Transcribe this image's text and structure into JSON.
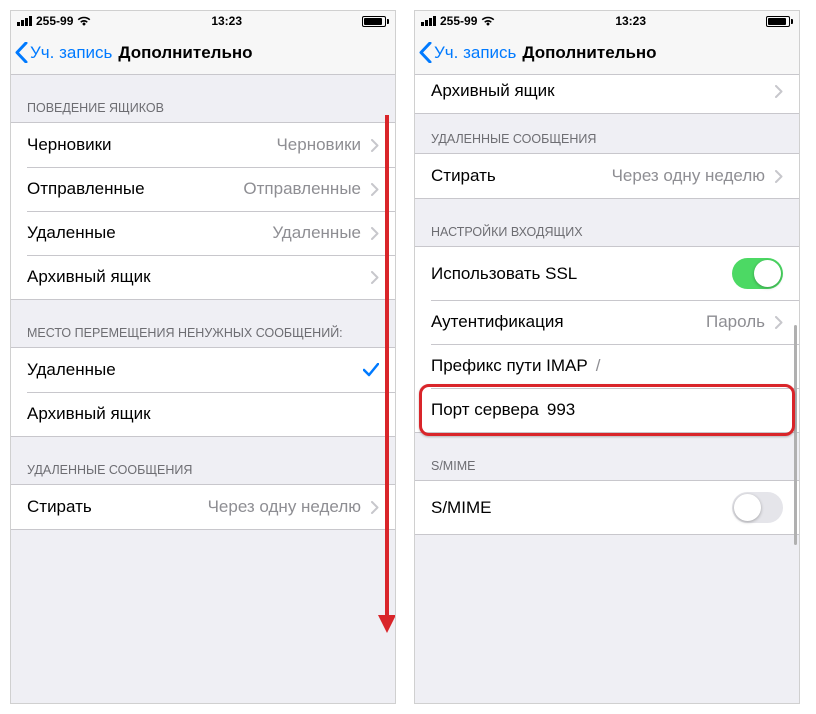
{
  "status": {
    "carrier": "255-99",
    "time": "13:23"
  },
  "nav": {
    "back": "Уч. запись",
    "title": "Дополнительно"
  },
  "left": {
    "sections": {
      "behavior_header": "ПОВЕДЕНИЕ ЯЩИКОВ",
      "drafts_label": "Черновики",
      "drafts_value": "Черновики",
      "sent_label": "Отправленные",
      "sent_value": "Отправленные",
      "deleted_label": "Удаленные",
      "deleted_value": "Удаленные",
      "archive_label": "Архивный ящик",
      "move_header": "МЕСТО ПЕРЕМЕЩЕНИЯ НЕНУЖНЫХ СООБЩЕНИЙ:",
      "move_deleted": "Удаленные",
      "move_archive": "Архивный ящик",
      "deleted_msgs_header": "УДАЛЕННЫЕ СООБЩЕНИЯ",
      "erase_label": "Стирать",
      "erase_value": "Через одну неделю"
    }
  },
  "right": {
    "sections": {
      "archive_label": "Архивный ящик",
      "deleted_msgs_header": "УДАЛЕННЫЕ СООБЩЕНИЯ",
      "erase_label": "Стирать",
      "erase_value": "Через одну неделю",
      "incoming_header": "НАСТРОЙКИ ВХОДЯЩИХ",
      "ssl_label": "Использовать SSL",
      "ssl_on": true,
      "auth_label": "Аутентификация",
      "auth_value": "Пароль",
      "imap_prefix_label": "Префикс пути IMAP",
      "imap_prefix_value": "/",
      "port_label": "Порт сервера",
      "port_value": "993",
      "smime_header": "S/MIME",
      "smime_label": "S/MIME",
      "smime_on": false
    }
  }
}
